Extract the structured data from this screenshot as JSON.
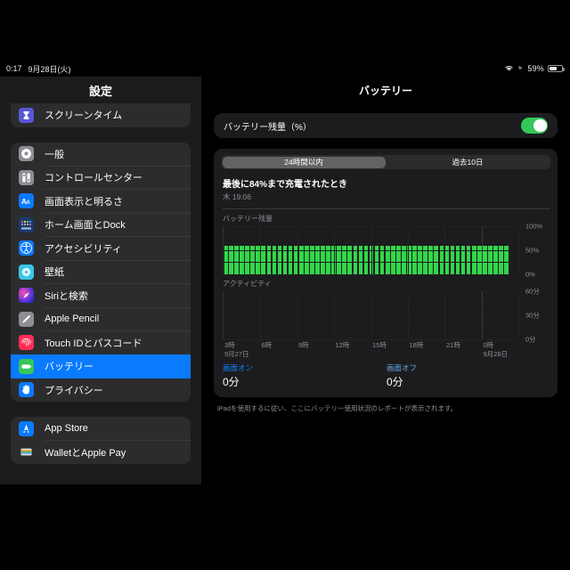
{
  "statusbar": {
    "time": "0:17",
    "date": "9月28日(火)",
    "battery_percent": "59%",
    "wifi_icon": "wifi-icon",
    "battery_icon": "battery-icon",
    "location_icon": "location-arrow-icon"
  },
  "sidebar": {
    "title": "設定",
    "groups": [
      {
        "items": [
          {
            "label": "スクリーンタイム",
            "icon": "hourglass-icon",
            "icon_class": "ic-screentime",
            "selected": false
          }
        ]
      },
      {
        "items": [
          {
            "label": "一般",
            "icon": "gear-icon",
            "icon_class": "ic-general",
            "selected": false
          },
          {
            "label": "コントロールセンター",
            "icon": "sliders-icon",
            "icon_class": "ic-control",
            "selected": false
          },
          {
            "label": "画面表示と明るさ",
            "icon": "text-size-icon",
            "icon_class": "ic-display",
            "selected": false
          },
          {
            "label": "ホーム画面とDock",
            "icon": "app-grid-icon",
            "icon_class": "ic-home",
            "selected": false
          },
          {
            "label": "アクセシビリティ",
            "icon": "accessibility-icon",
            "icon_class": "ic-access",
            "selected": false
          },
          {
            "label": "壁紙",
            "icon": "wallpaper-flower-icon",
            "icon_class": "ic-wall",
            "selected": false
          },
          {
            "label": "Siriと検索",
            "icon": "siri-orb-icon",
            "icon_class": "ic-siri",
            "selected": false
          },
          {
            "label": "Apple Pencil",
            "icon": "pencil-icon",
            "icon_class": "ic-pencil",
            "selected": false
          },
          {
            "label": "Touch IDとパスコード",
            "icon": "fingerprint-icon",
            "icon_class": "ic-touchid",
            "selected": false
          },
          {
            "label": "バッテリー",
            "icon": "battery-icon",
            "icon_class": "ic-battery",
            "selected": true
          },
          {
            "label": "プライバシー",
            "icon": "hand-icon",
            "icon_class": "ic-privacy",
            "selected": false
          }
        ]
      },
      {
        "items": [
          {
            "label": "App Store",
            "icon": "appstore-icon",
            "icon_class": "ic-appstore",
            "selected": false
          },
          {
            "label": "WalletとApple Pay",
            "icon": "wallet-icon",
            "icon_class": "ic-wallet",
            "selected": false
          }
        ]
      }
    ]
  },
  "detail": {
    "title": "バッテリー",
    "toggle_label": "バッテリー残量（%）",
    "toggle_on": true,
    "segments": [
      {
        "label": "24時間以内",
        "selected": true
      },
      {
        "label": "過去10日",
        "selected": false
      }
    ],
    "last_charge_title": "最後に84%まで充電されたとき",
    "last_charge_time": "木 19:06",
    "summary": [
      {
        "label": "画面オン",
        "value": "0分"
      },
      {
        "label": "画面オフ",
        "value": "0分"
      }
    ],
    "footnote": "iPadを使用するに従い、ここにバッテリー使用状況のレポートが表示されます。"
  },
  "chart_data": [
    {
      "type": "bar",
      "title": "バッテリー残量",
      "xlabel": "",
      "ylabel": "",
      "ylim": [
        0,
        100
      ],
      "yticks": [
        0,
        50,
        100
      ],
      "ytick_labels": [
        "0%",
        "50%",
        "100%"
      ],
      "grid": true,
      "bar_color": "#32d74b",
      "n_bars": 53,
      "values": [
        59,
        59,
        59,
        59,
        59,
        59,
        59,
        59,
        59,
        59,
        59,
        59,
        59,
        59,
        59,
        59,
        59,
        59,
        59,
        59,
        59,
        59,
        59,
        59,
        59,
        59,
        59,
        59,
        59,
        59,
        59,
        59,
        59,
        59,
        59,
        59,
        59,
        59,
        59,
        59,
        59,
        59,
        59,
        59,
        59,
        59,
        59,
        59,
        59,
        59,
        59,
        59,
        59
      ]
    },
    {
      "type": "bar",
      "title": "アクティビティ",
      "xlabel": "",
      "ylabel": "",
      "ylim": [
        0,
        60
      ],
      "yticks": [
        0,
        30,
        60
      ],
      "ytick_labels": [
        "0分",
        "30分",
        "60分"
      ],
      "grid": true,
      "xticks": [
        "3時",
        "6時",
        "9時",
        "12時",
        "15時",
        "18時",
        "21時",
        "0時"
      ],
      "xtick_dates": [
        "9月27日",
        "",
        "",
        "",
        "",
        "",
        "",
        "9月28日"
      ],
      "values": [
        0,
        0,
        0,
        0,
        0,
        0,
        0,
        0
      ]
    }
  ]
}
